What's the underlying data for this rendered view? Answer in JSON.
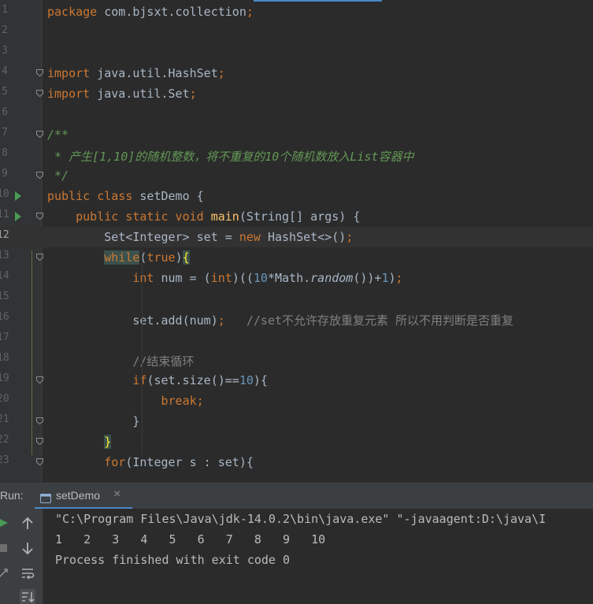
{
  "editor": {
    "current_line": "12",
    "lines": [
      {
        "n": "1",
        "code": [
          {
            "t": "package ",
            "c": "kw"
          },
          {
            "t": "com.bjsxt.collection",
            "c": "plain"
          },
          {
            "t": ";",
            "c": "kw"
          }
        ]
      },
      {
        "n": "2",
        "code": []
      },
      {
        "n": "3",
        "code": []
      },
      {
        "n": "4",
        "code": [
          {
            "t": "import ",
            "c": "kw"
          },
          {
            "t": "java.util.HashSet",
            "c": "plain"
          },
          {
            "t": ";",
            "c": "kw"
          }
        ]
      },
      {
        "n": "5",
        "code": [
          {
            "t": "import ",
            "c": "kw"
          },
          {
            "t": "java.util.Set",
            "c": "plain"
          },
          {
            "t": ";",
            "c": "kw"
          }
        ]
      },
      {
        "n": "6",
        "code": []
      },
      {
        "n": "7",
        "code": [
          {
            "t": "/**",
            "c": "doc"
          }
        ]
      },
      {
        "n": "8",
        "code": [
          {
            "t": " * 产生[1,10]的随机整数，将不重复的10个随机数放入List容器中",
            "c": "doc"
          }
        ]
      },
      {
        "n": "9",
        "code": [
          {
            "t": " */",
            "c": "doc"
          }
        ]
      },
      {
        "n": "10",
        "code": [
          {
            "t": "public class ",
            "c": "kw"
          },
          {
            "t": "setDemo {",
            "c": "plain"
          }
        ]
      },
      {
        "n": "11",
        "code": [
          {
            "t": "    ",
            "c": "plain"
          },
          {
            "t": "public static void ",
            "c": "kw"
          },
          {
            "t": "main",
            "c": "fn"
          },
          {
            "t": "(String[] args) {",
            "c": "plain"
          }
        ]
      },
      {
        "n": "12",
        "code": [
          {
            "t": "        Set<Integer> set = ",
            "c": "plain"
          },
          {
            "t": "new ",
            "c": "kw"
          },
          {
            "t": "HashSet<>()",
            "c": "plain"
          },
          {
            "t": ";",
            "c": "kw"
          }
        ]
      },
      {
        "n": "13",
        "code": [
          {
            "t": "        ",
            "c": "plain"
          },
          {
            "t": "while",
            "c": "kw mhw"
          },
          {
            "t": "(",
            "c": "plain"
          },
          {
            "t": "true",
            "c": "kw"
          },
          {
            "t": ")",
            "c": "plain"
          },
          {
            "t": "{",
            "c": "mh"
          }
        ]
      },
      {
        "n": "14",
        "code": [
          {
            "t": "            ",
            "c": "plain"
          },
          {
            "t": "int ",
            "c": "kw"
          },
          {
            "t": "num = (",
            "c": "plain"
          },
          {
            "t": "int",
            "c": "kw"
          },
          {
            "t": ")((",
            "c": "plain"
          },
          {
            "t": "10",
            "c": "num"
          },
          {
            "t": "*Math.",
            "c": "plain"
          },
          {
            "t": "random",
            "c": "it"
          },
          {
            "t": "())+",
            "c": "plain"
          },
          {
            "t": "1",
            "c": "num"
          },
          {
            "t": ")",
            "c": "plain"
          },
          {
            "t": ";",
            "c": "kw"
          }
        ]
      },
      {
        "n": "15",
        "code": []
      },
      {
        "n": "16",
        "code": [
          {
            "t": "            set.add(num)",
            "c": "plain"
          },
          {
            "t": ";   ",
            "c": "kw"
          },
          {
            "t": "//set不允许存放重复元素 所以不用判断是否重复",
            "c": "cm"
          }
        ]
      },
      {
        "n": "17",
        "code": []
      },
      {
        "n": "18",
        "code": [
          {
            "t": "            ",
            "c": "plain"
          },
          {
            "t": "//结束循环",
            "c": "cm"
          }
        ]
      },
      {
        "n": "19",
        "code": [
          {
            "t": "            ",
            "c": "plain"
          },
          {
            "t": "if",
            "c": "kw"
          },
          {
            "t": "(set.size()==",
            "c": "plain"
          },
          {
            "t": "10",
            "c": "num"
          },
          {
            "t": "){",
            "c": "plain"
          }
        ]
      },
      {
        "n": "20",
        "code": [
          {
            "t": "                ",
            "c": "plain"
          },
          {
            "t": "break;",
            "c": "kw"
          }
        ]
      },
      {
        "n": "21",
        "code": [
          {
            "t": "            }",
            "c": "plain"
          }
        ]
      },
      {
        "n": "22",
        "code": [
          {
            "t": "        ",
            "c": "plain"
          },
          {
            "t": "}",
            "c": "mh"
          }
        ]
      },
      {
        "n": "23",
        "code": [
          {
            "t": "        ",
            "c": "plain"
          },
          {
            "t": "for",
            "c": "kw"
          },
          {
            "t": "(Integer s : set){",
            "c": "plain"
          }
        ]
      }
    ]
  },
  "run_panel": {
    "label": "Run:",
    "tab_label": "setDemo",
    "close_glyph": "×",
    "output": [
      "\"C:\\Program Files\\Java\\jdk-14.0.2\\bin\\java.exe\" \"-javaagent:D:\\java\\I",
      "1   2   3   4   5   6   7   8   9   10",
      "Process finished with exit code 0"
    ]
  },
  "colors": {
    "keyword": "#cc7832",
    "method": "#ffc66d",
    "number": "#6897bb",
    "comment": "#808080",
    "doc_comment": "#629755",
    "text": "#a9b7c6",
    "run_green": "#499c54",
    "accent_blue": "#4a88c7"
  },
  "icons": {
    "run_gutter": "run-triangle-icon",
    "fold": "fold-marker-icon",
    "rerun": "rerun-icon",
    "stop": "stop-icon",
    "scroll_up": "arrow-up-icon",
    "scroll_down": "arrow-down-icon",
    "soft_wrap": "soft-wrap-icon",
    "sort": "sort-icon",
    "tab": "application-icon"
  }
}
